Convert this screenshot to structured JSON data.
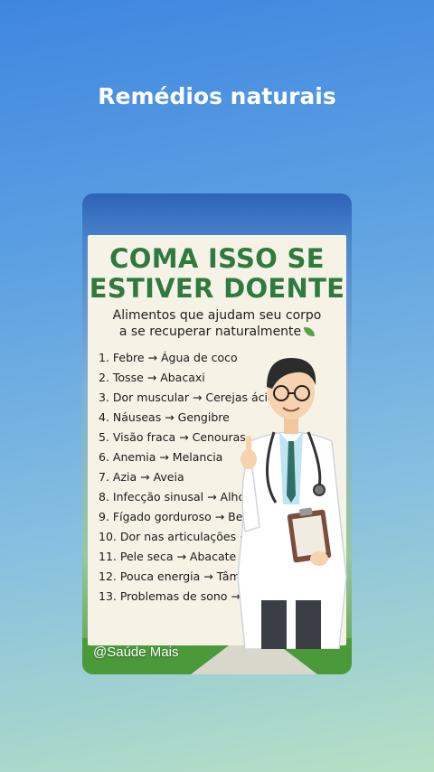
{
  "page": {
    "title": "Remédios naturais"
  },
  "card": {
    "headline_line1": "COMA ISSO SE",
    "headline_line2": "ESTIVER DOENTE",
    "subtitle_line1": "Alimentos que ajudam seu corpo",
    "subtitle_line2": "a se recuperar naturalmente",
    "subtitle_icon": "leaf-icon",
    "items": [
      "1. Febre → Água de coco",
      "2. Tosse → Abacaxi",
      "3. Dor muscular → Cerejas ácidas",
      "4. Náuseas → Gengibre",
      "5. Visão fraca → Cenouras",
      "6. Anemia → Melancia",
      "7. Azia → Aveia",
      "8. Infecção sinusal → Alho",
      "9. Fígado gorduroso → Beterraba",
      "10. Dor nas articulações → Nozes",
      "11. Pele seca → Abacate",
      "12. Pouca energia → Tâmaras",
      "13. Problemas de sono → Banana"
    ],
    "watermark": "@Saúde Mais",
    "illustration": "doctor-illustration"
  },
  "colors": {
    "headline": "#2f7a3e",
    "poster_bg": "#f6f2e6",
    "bg_top": "#3f86e0",
    "bg_bottom": "#b6e0c4"
  }
}
